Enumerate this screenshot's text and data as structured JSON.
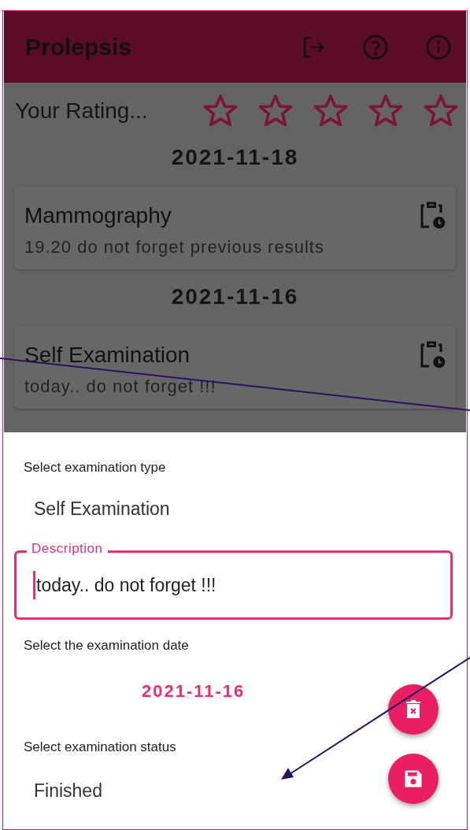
{
  "app_bar": {
    "title": "Prolepsis"
  },
  "rating": {
    "label": "Your Rating...",
    "stars": 0
  },
  "entries": [
    {
      "date": "2021-11-18",
      "title": "Mammography",
      "note": "19.20 do not forget previous results"
    },
    {
      "date": "2021-11-16",
      "title": "Self Examination",
      "note": "today.. do not forget !!!"
    }
  ],
  "sheet": {
    "type_label": "Select examination type",
    "type_value": "Self Examination",
    "description": {
      "label": "Description",
      "value": "today.. do not forget !!!",
      "focused": true
    },
    "date_label": "Select the examination date",
    "date_value": "2021-11-16",
    "status_label": "Select examination status",
    "status_value": "Finished"
  }
}
